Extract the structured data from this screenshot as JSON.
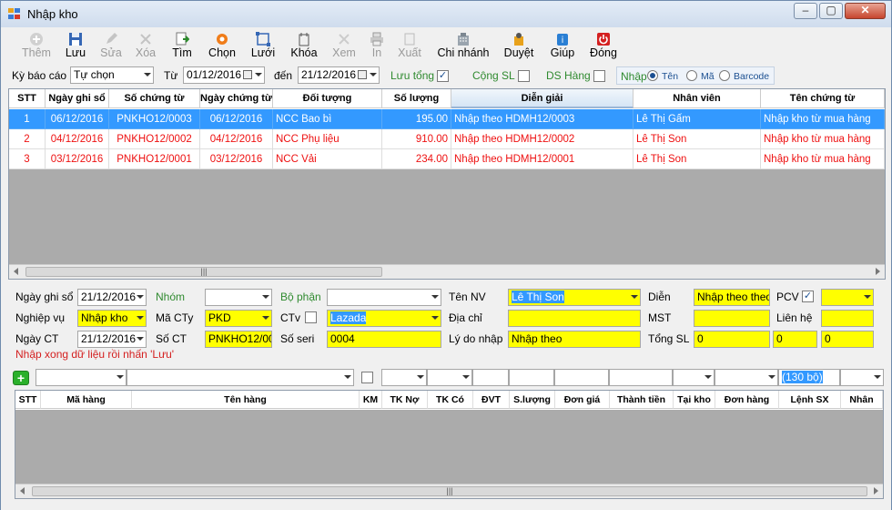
{
  "window": {
    "title": "Nhập kho"
  },
  "toolbar": {
    "items": [
      {
        "label": "Thêm",
        "icon": "plus-circle-icon",
        "enabled": false
      },
      {
        "label": "Lưu",
        "icon": "floppy-disk-icon",
        "enabled": true
      },
      {
        "label": "Sửa",
        "icon": "pencil-icon",
        "enabled": false
      },
      {
        "label": "Xóa",
        "icon": "x-icon",
        "enabled": false
      },
      {
        "label": "Tìm",
        "icon": "find-icon",
        "enabled": true
      },
      {
        "label": "Chọn",
        "icon": "gear-icon",
        "enabled": true
      },
      {
        "label": "Lưới",
        "icon": "grid-icon",
        "enabled": true
      },
      {
        "label": "Khóa",
        "icon": "lock-icon",
        "enabled": true
      },
      {
        "label": "Xem",
        "icon": "view-icon",
        "enabled": false
      },
      {
        "label": "In",
        "icon": "printer-icon",
        "enabled": false
      },
      {
        "label": "Xuất",
        "icon": "export-icon",
        "enabled": false
      },
      {
        "label": "Chi nhánh",
        "icon": "building-icon",
        "enabled": true
      },
      {
        "label": "Duyệt",
        "icon": "approve-icon",
        "enabled": true
      },
      {
        "label": "Giúp",
        "icon": "help-book-icon",
        "enabled": true
      },
      {
        "label": "Đóng",
        "icon": "power-icon",
        "enabled": true
      }
    ]
  },
  "filters": {
    "period_label": "Kỳ báo cáo",
    "period_value": "Tự chọn",
    "from_label": "Từ",
    "from_date": "01/12/2016",
    "to_label": "đến",
    "to_date": "21/12/2016",
    "save_total_label": "Lưu tổng",
    "save_total_checked": true,
    "sum_qty_label": "Cộng SL",
    "sum_qty_checked": false,
    "items_list_label": "DS Hàng",
    "items_list_checked": false,
    "input_label": "Nhập",
    "radio_name": "Tên",
    "radio_code": "Mã",
    "radio_barcode": "Barcode",
    "radio_selected": "Tên"
  },
  "main_grid": {
    "columns": [
      "STT",
      "Ngày ghi sổ",
      "Số chứng từ",
      "Ngày chứng từ",
      "Đối tượng",
      "Số lượng",
      "Diễn giải",
      "Nhân viên",
      "Tên chứng từ"
    ],
    "rows": [
      [
        "1",
        "06/12/2016",
        "PNKHO12/0003",
        "06/12/2016",
        "NCC Bao bì",
        "195.00",
        "Nhập theo HDMH12/0003",
        "Lê Thị Gấm",
        "Nhập kho từ mua hàng"
      ],
      [
        "2",
        "04/12/2016",
        "PNKHO12/0002",
        "04/12/2016",
        "NCC Phụ liệu",
        "910.00",
        "Nhập theo HDMH12/0002",
        "Lê Thị Son",
        "Nhập kho từ mua hàng"
      ],
      [
        "3",
        "03/12/2016",
        "PNKHO12/0001",
        "03/12/2016",
        "NCC Vải",
        "234.00",
        "Nhập theo HDMH12/0001",
        "Lê Thị Son",
        "Nhập kho từ mua hàng"
      ]
    ],
    "selected_row": 1
  },
  "form": {
    "ngay_ghi_so_label": "Ngày ghi sổ",
    "ngay_ghi_so": "21/12/2016",
    "nhom_label": "Nhóm",
    "nhom": "",
    "bo_phan_label": "Bộ phận",
    "bo_phan": "",
    "ten_nv_label": "Tên NV",
    "ten_nv": "Lê Thị Son",
    "dien_label": "Diễn",
    "dien": "Nhập theo  theo",
    "pcv_label": "PCV",
    "pcv_checked": true,
    "pcv_value": "",
    "nghiep_vu_label": "Nghiệp vụ",
    "nghiep_vu": "Nhập kho",
    "ma_cty_label": "Mã CTy",
    "ma_cty": "PKD",
    "ctv_label": "CTv",
    "ctv_checked": false,
    "ctv_value": "Lazada",
    "dia_chi_label": "Địa chỉ",
    "dia_chi": "",
    "mst_label": "MST",
    "mst": "",
    "lien_he_label": "Liên hệ",
    "lien_he": "",
    "ngay_ct_label": "Ngày CT",
    "ngay_ct": "21/12/2016",
    "so_ct_label": "Số CT",
    "so_ct": "PNKHO12/00",
    "so_seri_label": "Số seri",
    "so_seri": "0004",
    "ly_do_label": "Lý do nhập",
    "ly_do": "Nhập theo",
    "tong_sl_label": "Tổng SL",
    "tong_1": "0",
    "tong_2": "0",
    "tong_3": "0",
    "message": "Nhập xong dữ liệu rồi nhấn 'Lưu'"
  },
  "detail_entry": {
    "add_label": "+",
    "percent_value": "(130 bộ)"
  },
  "detail_grid": {
    "columns": [
      "STT",
      "Mã hàng",
      "Tên hàng",
      "KM",
      "TK Nợ",
      "TK Có",
      "ĐVT",
      "S.lượng",
      "Đơn giá",
      "Thành tiền",
      "Tại kho",
      "Đơn hàng",
      "Lệnh SX",
      "Nhân"
    ]
  }
}
